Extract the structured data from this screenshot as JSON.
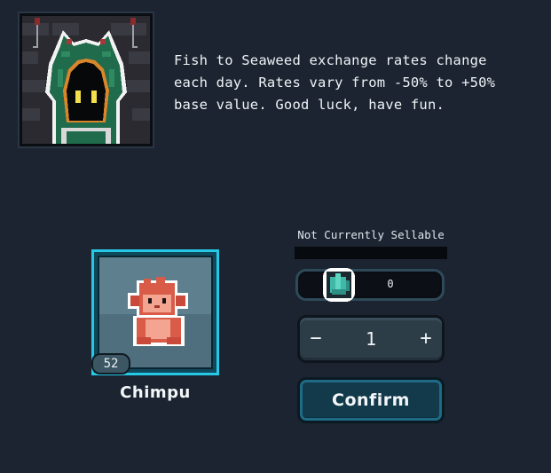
{
  "merchant": {
    "portrait_icon": "hooded-merchant-icon",
    "dialog": "Fish to Seaweed exchange rates change\neach day. Rates vary from -50% to +50%\nbase value. Good luck, have fun."
  },
  "item": {
    "name": "Chimpu",
    "count": "52",
    "sprite_icon": "chimpu-monkey-icon",
    "selected": true
  },
  "sell_panel": {
    "status": "Not Currently Sellable",
    "currency_icon": "seaweed-icon",
    "price": "0",
    "quantity": "1",
    "minus_label": "−",
    "plus_label": "+",
    "confirm_label": "Confirm"
  },
  "colors": {
    "background": "#1b2430",
    "selection_border": "#27c7e6",
    "confirm_bg": "#123a4b"
  }
}
